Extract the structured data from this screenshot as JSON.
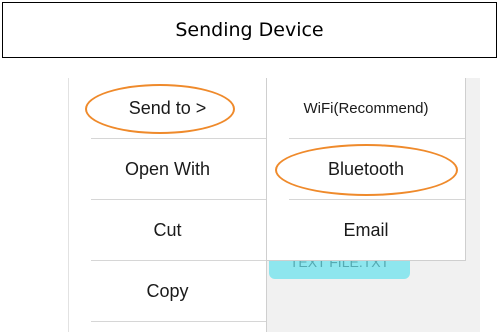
{
  "title": "Sending Device",
  "left_menu": {
    "items": [
      {
        "label": "Send to >"
      },
      {
        "label": "Open With"
      },
      {
        "label": "Cut"
      },
      {
        "label": "Copy"
      }
    ]
  },
  "submenu": {
    "items": [
      {
        "label": "WiFi(Recommend)"
      },
      {
        "label": "Bluetooth"
      },
      {
        "label": "Email"
      }
    ]
  },
  "background_button": {
    "label": "TEXT FILE.TXT"
  },
  "colors": {
    "highlight": "#ef8a2b",
    "cyan_button": "#8ee6ee"
  }
}
